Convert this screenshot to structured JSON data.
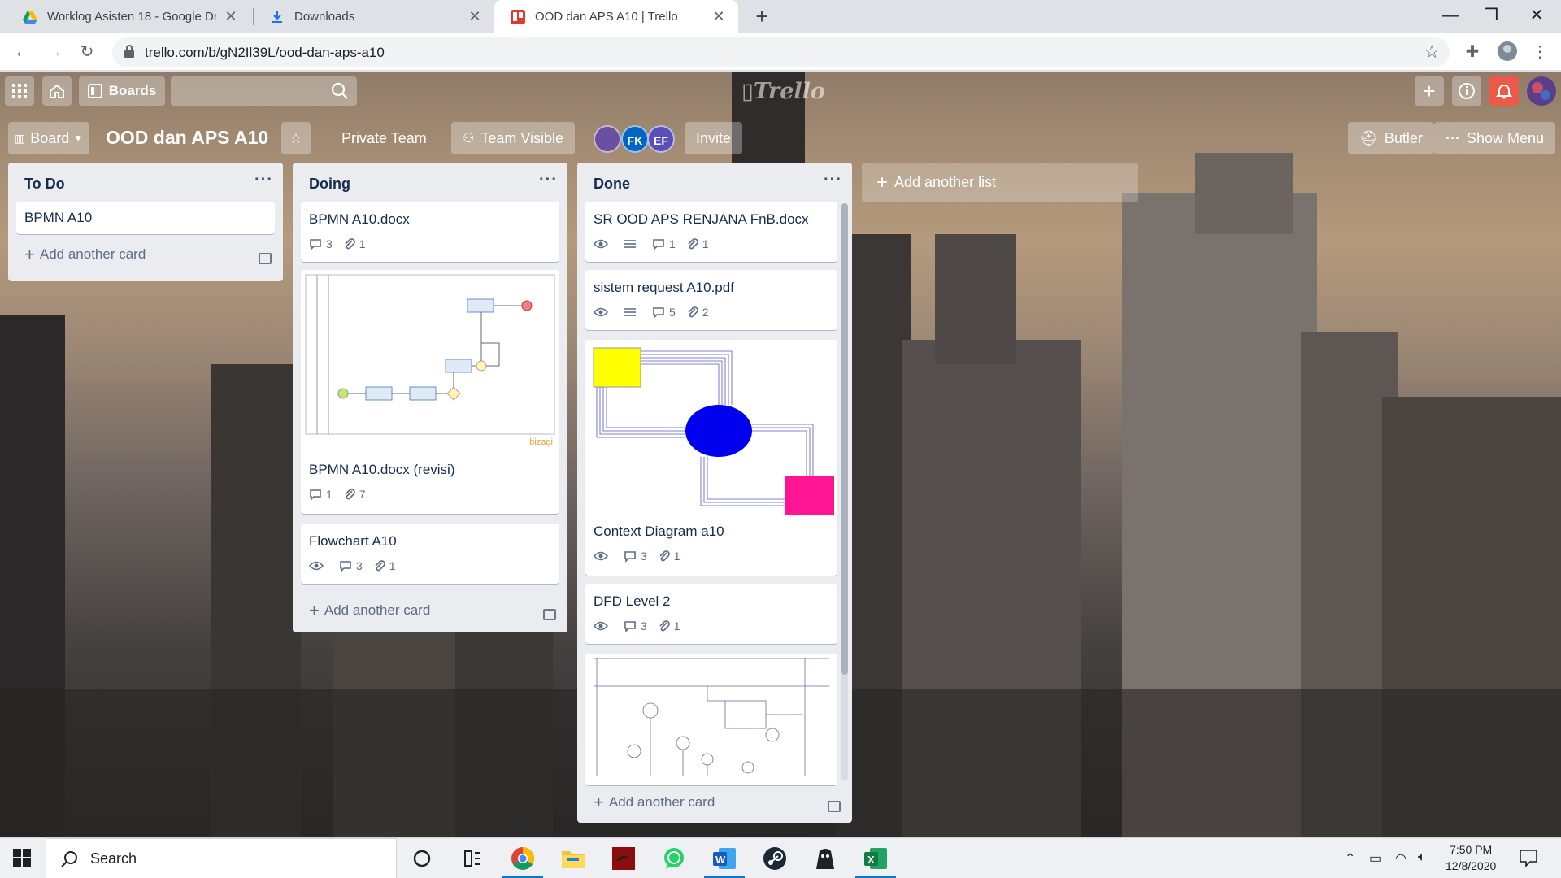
{
  "browser": {
    "tabs": [
      {
        "title": "Worklog Asisten 18 - Google Dri",
        "icon": "google-drive-icon",
        "active": false
      },
      {
        "title": "Downloads",
        "icon": "download-icon",
        "active": false
      },
      {
        "title": "OOD dan APS A10 | Trello",
        "icon": "trello-icon",
        "active": true
      }
    ],
    "url": "trello.com/b/gN2Il39L/ood-dan-aps-a10"
  },
  "trello_header": {
    "boards_label": "Boards",
    "logo": "Trello"
  },
  "board": {
    "view_label": "Board",
    "title": "OOD dan APS A10",
    "team_label": "Private Team",
    "visibility_label": "Team Visible",
    "members": [
      {
        "initials": "",
        "color": "#6b4fa0"
      },
      {
        "initials": "FK",
        "color": "#0065c3"
      },
      {
        "initials": "EF",
        "color": "#5a4fb8"
      }
    ],
    "invite_label": "Invite",
    "butler_label": "Butler",
    "menu_label": "Show Menu"
  },
  "lists": [
    {
      "title": "To Do",
      "cards": [
        {
          "title": "BPMN A10"
        }
      ],
      "add_card_label": "Add another card"
    },
    {
      "title": "Doing",
      "cards": [
        {
          "title": "BPMN A10.docx",
          "comments": "3",
          "attachments": "1"
        },
        {
          "title": "BPMN A10.docx (revisi)",
          "comments": "1",
          "attachments": "7",
          "cover": "bpmn-diagram-thumbnail",
          "cover_label": "bizagi"
        },
        {
          "title": "Flowchart A10",
          "comments": "3",
          "attachments": "1"
        }
      ],
      "add_card_label": "Add another card"
    },
    {
      "title": "Done",
      "cards": [
        {
          "title": "SR OOD APS RENJANA FnB.docx",
          "comments": "1",
          "attachments": "1"
        },
        {
          "title": "sistem request A10.pdf",
          "comments": "5",
          "attachments": "2"
        },
        {
          "title": "Context Diagram a10",
          "comments": "3",
          "attachments": "1",
          "cover": "context-diagram-thumbnail"
        },
        {
          "title": "DFD Level 2",
          "comments": "3",
          "attachments": "1"
        },
        {
          "title": "",
          "cover": "dfd-diagram-thumbnail"
        }
      ],
      "add_card_label": "Add another card"
    }
  ],
  "add_list_label": "Add another list",
  "taskbar": {
    "search_label": "Search",
    "time": "7:50 PM",
    "date": "12/8/2020"
  }
}
